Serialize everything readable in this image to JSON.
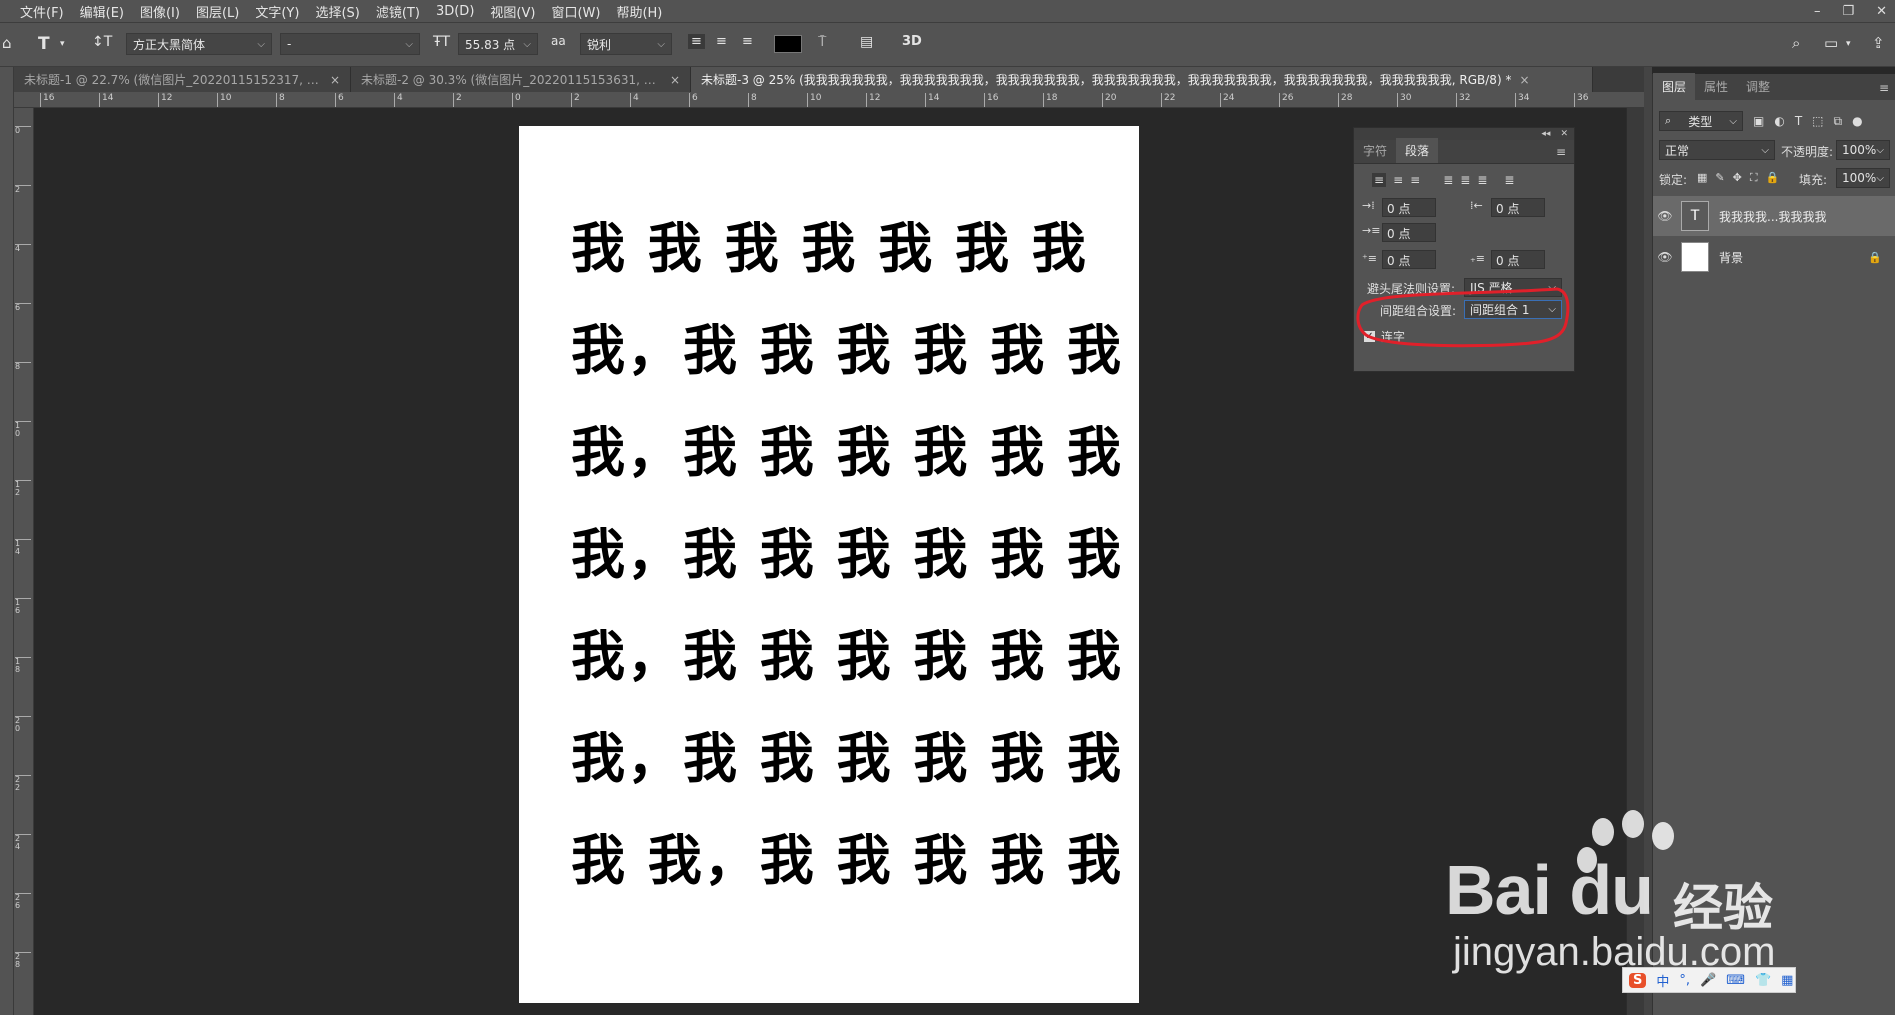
{
  "menubar": {
    "items": [
      "文件(F)",
      "编辑(E)",
      "图像(I)",
      "图层(L)",
      "文字(Y)",
      "选择(S)",
      "滤镜(T)",
      "3D(D)",
      "视图(V)",
      "窗口(W)",
      "帮助(H)"
    ],
    "window_controls": [
      "–",
      "❐",
      "✕"
    ]
  },
  "options": {
    "font_family": "方正大黑简体",
    "font_style": "-",
    "font_size": "55.83 点",
    "antialias_icon_label": "aa",
    "antialias": "锐利",
    "warp_3d_label": "3D"
  },
  "tabs": [
    {
      "label": "未标题-1 @ 22.7% (微信图片_20220115152317, RGB/8...",
      "close": "×"
    },
    {
      "label": "未标题-2 @ 30.3% (微信图片_20220115153631, RGB/8...",
      "close": "×"
    },
    {
      "label": "未标题-3 @ 25% (我我我我我我我，我我我我我我我，我我我我我我我，我我我我我我我，我我我我我我我，我我我我我我我，我我我我我我, RGB/8) *",
      "close": "×"
    }
  ],
  "ruler": {
    "h_ticks": [
      "16",
      "14",
      "12",
      "10",
      "8",
      "6",
      "4",
      "2",
      "0",
      "2",
      "4",
      "6",
      "8",
      "10",
      "12",
      "14",
      "16",
      "18",
      "20",
      "22",
      "24",
      "26",
      "28",
      "30",
      "32",
      "34",
      "36"
    ],
    "v_ticks": [
      "0",
      "2",
      "4",
      "6",
      "8",
      "1\n0",
      "1\n2",
      "1\n4",
      "1\n6",
      "1\n8",
      "2\n0",
      "2\n2",
      "2\n4",
      "2\n6",
      "2\n8"
    ]
  },
  "document": {
    "lines": [
      "我 我 我 我 我 我 我",
      "我，我 我 我 我 我 我",
      "我，我 我 我 我 我 我",
      "我，我 我 我 我 我 我",
      "我，我 我 我 我 我 我",
      "我，我 我 我 我 我 我",
      "我 我，我 我 我 我 我"
    ]
  },
  "paragraph_panel": {
    "tabs": [
      "字符",
      "段落"
    ],
    "active_tab": "段落",
    "menu_icon": "≡",
    "collapse": "◂◂",
    "close": "✕",
    "indent_left": "0 点",
    "indent_right": "0 点",
    "indent_first": "0 点",
    "space_before": "0 点",
    "space_after": "0 点",
    "kinsoku_label": "避头尾法则设置:",
    "kinsoku_value": "JIS 严格",
    "mojikumi_label": "间距组合设置:",
    "mojikumi_value": "间距组合 1",
    "hyphenate_label": "连字",
    "hyphenate_checked": true,
    "highlight_color": "#e0202a"
  },
  "layers_panel": {
    "tabs": [
      "图层",
      "属性",
      "调整"
    ],
    "active_tab": "图层",
    "filter_kind": "类型",
    "blend_mode": "正常",
    "opacity_label": "不透明度:",
    "opacity": "100%",
    "lock_label": "锁定:",
    "fill_label": "填充:",
    "fill": "100%",
    "layers": [
      {
        "name": "我我我我...我我我我",
        "type": "text",
        "selected": true
      },
      {
        "name": "背景",
        "type": "background",
        "selected": false,
        "locked": true
      }
    ]
  },
  "watermark": {
    "logo": "Bai  du",
    "logo_cn": "经验",
    "url": "jingyan.baidu.com"
  },
  "ime": {
    "items": [
      "S",
      "中",
      "°,",
      "🎤",
      "⌨",
      "👕",
      "▦"
    ]
  }
}
